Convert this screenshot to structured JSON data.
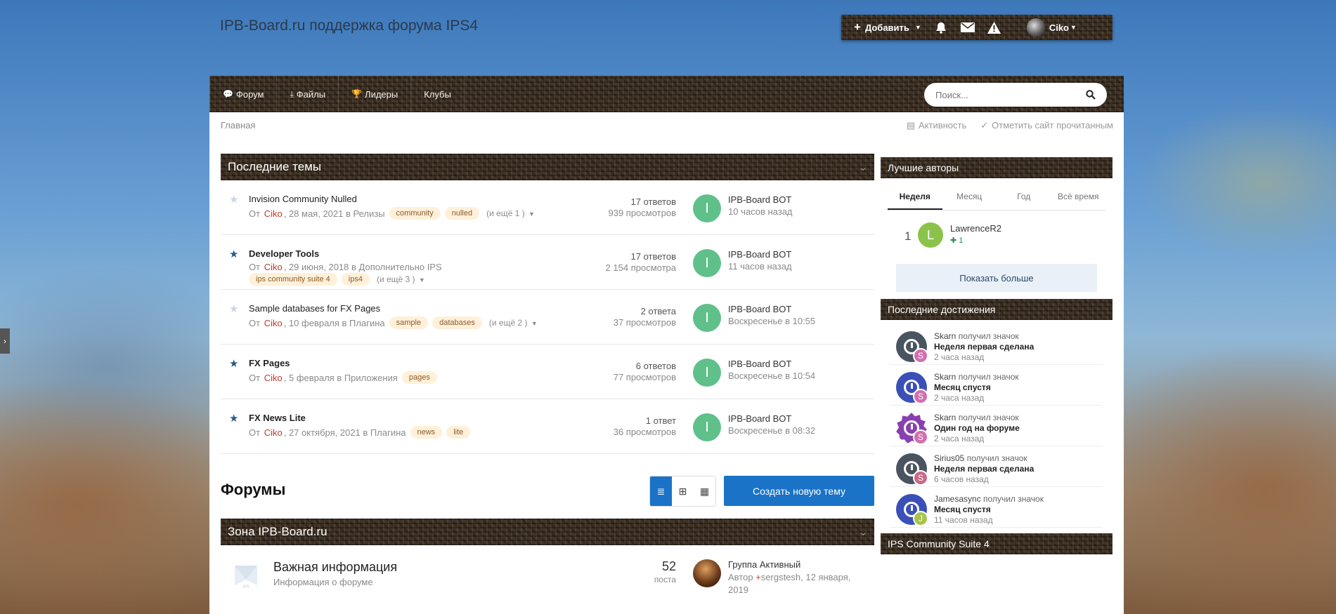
{
  "site": {
    "title": "IPB-Board.ru поддержка форума IPS4"
  },
  "userbar": {
    "add_label": "Добавить",
    "username": "Ciko"
  },
  "nav": {
    "items": [
      {
        "icon": "chat-icon",
        "label": "Форум"
      },
      {
        "icon": "download-icon",
        "label": "Файлы"
      },
      {
        "icon": "trophy-icon",
        "label": "Лидеры"
      },
      {
        "icon": "",
        "label": "Клубы"
      }
    ],
    "search_placeholder": "Поиск..."
  },
  "breadcrumb": {
    "home": "Главная",
    "activity": "Активность",
    "mark_read": "Отметить сайт прочитанным"
  },
  "recent_topics": {
    "title": "Последние темы",
    "rows": [
      {
        "starred": false,
        "bold": false,
        "title": "Invision Community Nulled",
        "prefix": "От",
        "author": "Ciko",
        "date_forum": ", 28 мая, 2021 в Релизы",
        "tags": [
          "community",
          "nulled"
        ],
        "more": "(и ещё 1 )",
        "replies": "17 ответов",
        "views": "939 просмотров",
        "last_avatar": "I",
        "last_user": "IPB-Board BOT",
        "last_time": "10 часов назад"
      },
      {
        "starred": true,
        "bold": true,
        "title": "Developer Tools",
        "prefix": "От",
        "author": "Ciko",
        "date_forum": ", 29 июня, 2018 в Дополнительно IPS",
        "tags": [
          "ips community suite 4",
          "ips4"
        ],
        "more": "(и ещё 3 )",
        "replies": "17 ответов",
        "views": "2 154 просмотра",
        "last_avatar": "I",
        "last_user": "IPB-Board BOT",
        "last_time": "11 часов назад"
      },
      {
        "starred": false,
        "bold": false,
        "title": "Sample databases for FX Pages",
        "prefix": "От",
        "author": "Ciko",
        "date_forum": ", 10 февраля в Плагина",
        "tags": [
          "sample",
          "databases"
        ],
        "more": "(и ещё 2 )",
        "replies": "2 ответа",
        "views": "37 просмотров",
        "last_avatar": "I",
        "last_user": "IPB-Board BOT",
        "last_time": "Воскресенье в 10:55"
      },
      {
        "starred": true,
        "bold": true,
        "title": "FX Pages",
        "prefix": "От",
        "author": "Ciko",
        "date_forum": ", 5 февраля в Приложения",
        "tags": [
          "pages"
        ],
        "more": "",
        "replies": "6 ответов",
        "views": "77 просмотров",
        "last_avatar": "I",
        "last_user": "IPB-Board BOT",
        "last_time": "Воскресенье в 10:54"
      },
      {
        "starred": true,
        "bold": true,
        "title": "FX News Lite",
        "prefix": "От",
        "author": "Ciko",
        "date_forum": ", 27 октября, 2021 в Плагина",
        "tags": [
          "news",
          "lite"
        ],
        "more": "",
        "replies": "1 ответ",
        "views": "36 просмотров",
        "last_avatar": "I",
        "last_user": "IPB-Board BOT",
        "last_time": "Воскресенье в 08:32"
      }
    ]
  },
  "forums": {
    "title": "Форумы",
    "create_label": "Создать новую тему",
    "section_title": "Зона IPB-Board.ru",
    "rows": [
      {
        "name": "Важная информация",
        "desc": "Информация о форуме",
        "count": "52",
        "count_label": "поста",
        "last_title": "Группа Активный",
        "last_prefix": "Автор",
        "last_author": "sergstesh",
        "last_date": ", 12 января, 2019"
      }
    ]
  },
  "top_authors": {
    "title": "Лучшие авторы",
    "tabs": [
      "Неделя",
      "Месяц",
      "Год",
      "Всё время"
    ],
    "active_tab": 0,
    "leaders": [
      {
        "rank": "1",
        "initial": "L",
        "name": "LawrenceR2",
        "rep": "1"
      }
    ],
    "show_more": "Показать больше"
  },
  "achievements": {
    "title": "Последние достижения",
    "items": [
      {
        "user": "Skarn",
        "action": "получил значок",
        "badge": "Неделя первая сделана",
        "time": "2 часа назад",
        "color": "#4a5460",
        "mini": "S",
        "mini_color": "#d06fb0"
      },
      {
        "user": "Skarn",
        "action": "получил значок",
        "badge": "Месяц спустя",
        "time": "2 часа назад",
        "color": "#3b4fb8",
        "mini": "S",
        "mini_color": "#d06fb0"
      },
      {
        "user": "Skarn",
        "action": "получил значок",
        "badge": "Один год на форуме",
        "time": "2 часа назад",
        "color": "#8a3fb0",
        "mini": "S",
        "mini_color": "#d06fb0"
      },
      {
        "user": "Sirius05",
        "action": "получил значок",
        "badge": "Неделя первая сделана",
        "time": "6 часов назад",
        "color": "#4a5460",
        "mini": "S",
        "mini_color": "#c96a8a"
      },
      {
        "user": "Jamesasync",
        "action": "получил значок",
        "badge": "Месяц спустя",
        "time": "11 часов назад",
        "color": "#3b4fb8",
        "mini": "J",
        "mini_color": "#a8c34a"
      }
    ]
  },
  "next_widget": {
    "title": "IPS Community Suite 4"
  }
}
